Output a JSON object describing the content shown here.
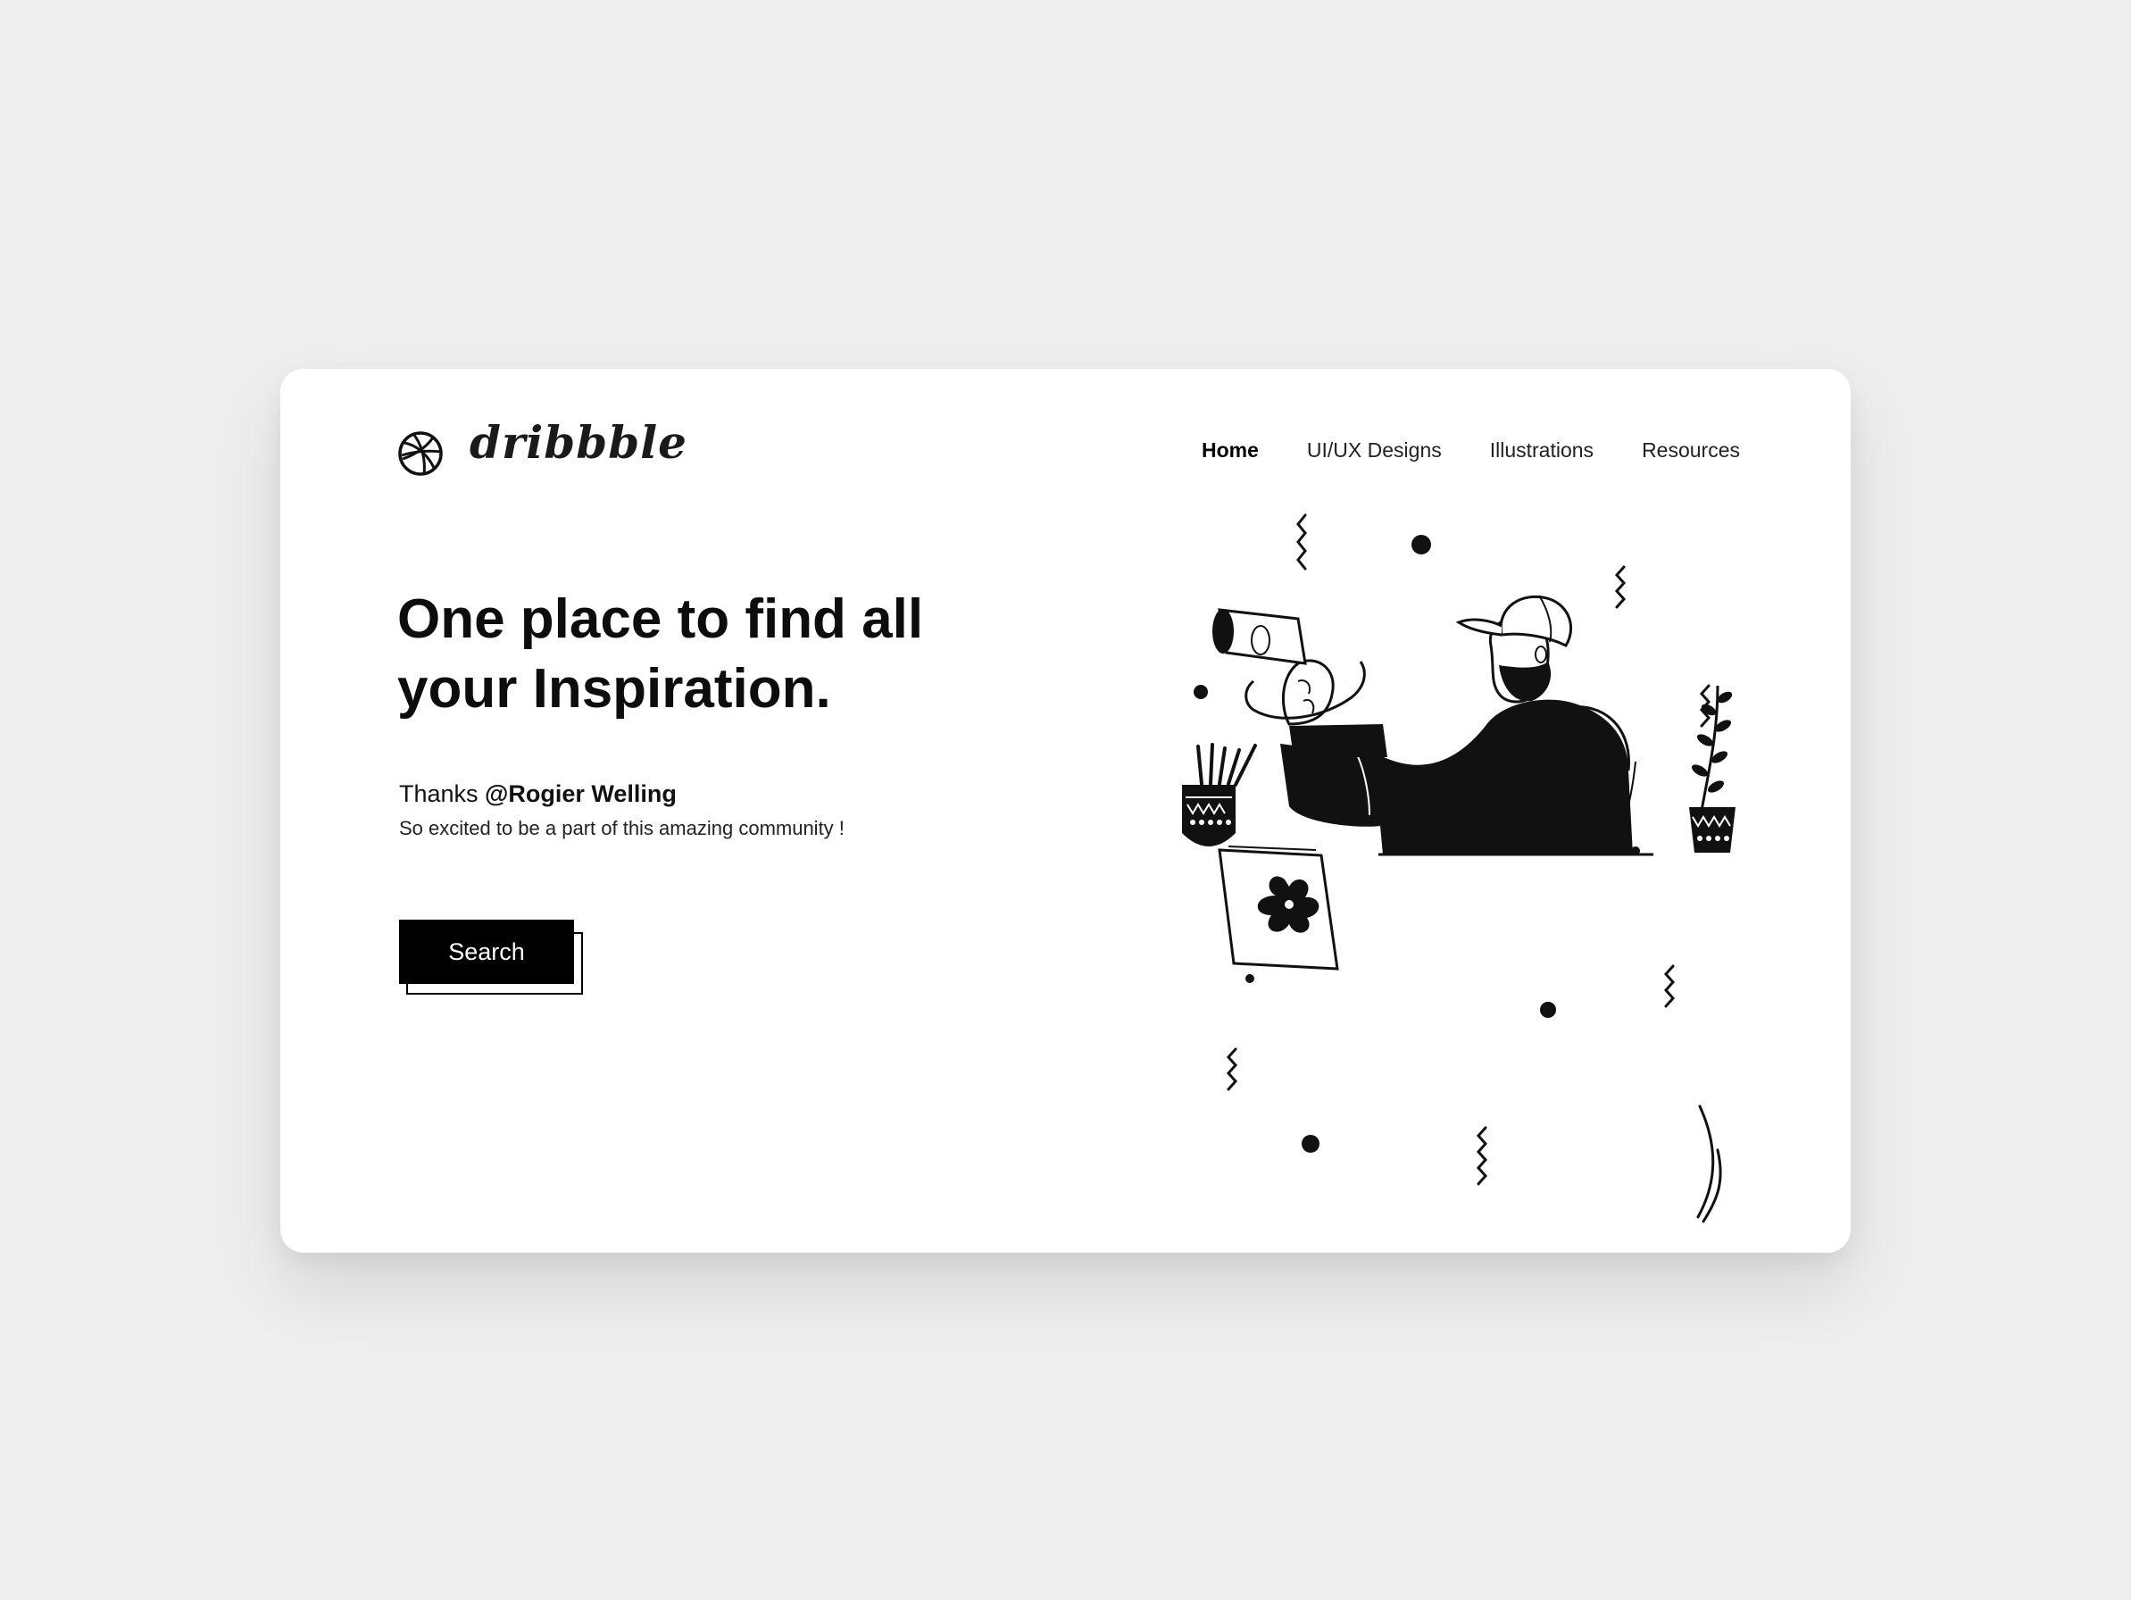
{
  "brand": {
    "name": "dribbble",
    "logo_icon": "dribbble-ball-icon"
  },
  "nav": {
    "items": [
      {
        "label": "Home",
        "active": true
      },
      {
        "label": "UI/UX Designs",
        "active": false
      },
      {
        "label": "Illustrations",
        "active": false
      },
      {
        "label": "Resources",
        "active": false
      }
    ]
  },
  "hero": {
    "headline_line1": "One place to find all",
    "headline_line2_prefix": "your ",
    "headline_line2_emphasis": "Inspiration.",
    "thanks_prefix": "Thanks ",
    "thanks_handle": "@Rogier Welling",
    "subtext": "So excited to be a part of this amazing community !",
    "button_label": "Search"
  },
  "illustration": {
    "icon": "man-with-binoculars-illustration"
  },
  "colors": {
    "background": "#eeeeee",
    "card": "#ffffff",
    "primary": "#000000",
    "button_text": "#ffffff"
  }
}
